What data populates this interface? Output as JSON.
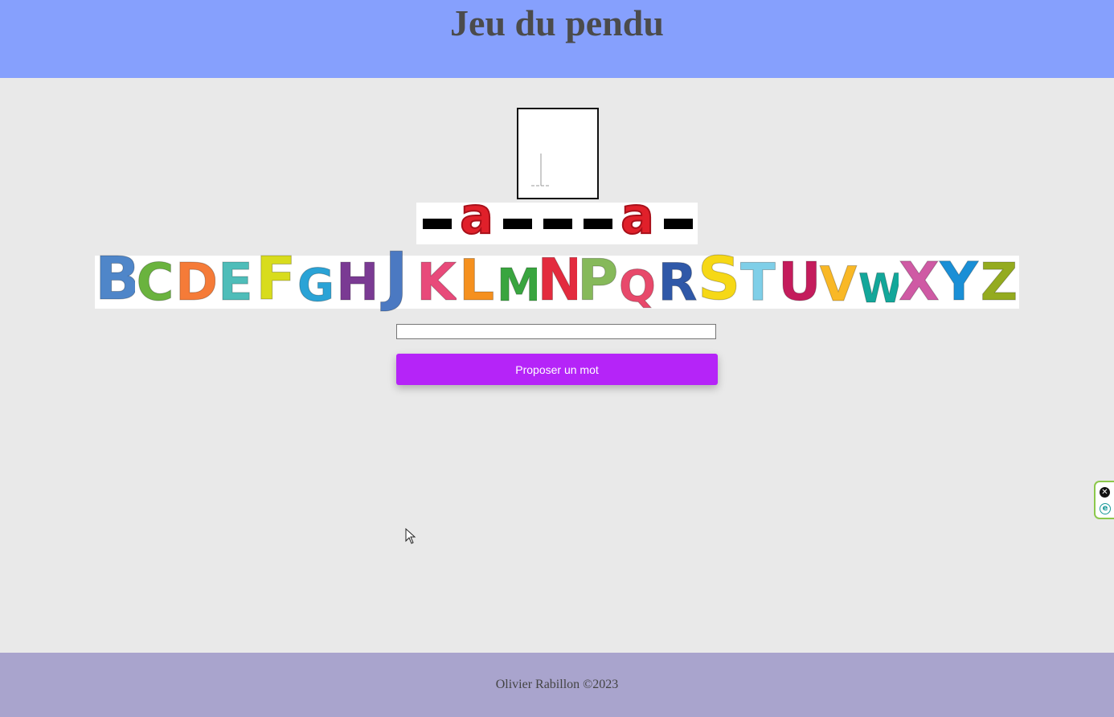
{
  "header": {
    "title": "Jeu du pendu"
  },
  "hangman": {
    "stage": 1
  },
  "word": {
    "slots": [
      {
        "revealed": false,
        "char": ""
      },
      {
        "revealed": true,
        "char": "a"
      },
      {
        "revealed": false,
        "char": ""
      },
      {
        "revealed": false,
        "char": ""
      },
      {
        "revealed": false,
        "char": ""
      },
      {
        "revealed": true,
        "char": "a"
      },
      {
        "revealed": false,
        "char": ""
      }
    ]
  },
  "alphabet": {
    "letters": [
      {
        "char": "B",
        "color": "#4f86c9",
        "size": 74
      },
      {
        "char": "C",
        "color": "#6ab33e",
        "size": 64
      },
      {
        "char": "D",
        "color": "#f57b38",
        "size": 64
      },
      {
        "char": "E",
        "color": "#4fbdb9",
        "size": 64
      },
      {
        "char": "F",
        "color": "#d8dc1d",
        "size": 74
      },
      {
        "char": "G",
        "color": "#2aa3d6",
        "size": 56
      },
      {
        "char": "H",
        "color": "#7a3a93",
        "size": 64
      },
      {
        "char": "J",
        "color": "#4b79c2",
        "size": 80
      },
      {
        "char": "K",
        "color": "#e84a7a",
        "size": 64
      },
      {
        "char": "L",
        "color": "#f5901e",
        "size": 70
      },
      {
        "char": "M",
        "color": "#39a53f",
        "size": 56
      },
      {
        "char": "N",
        "color": "#e32b3e",
        "size": 72
      },
      {
        "char": "P",
        "color": "#86b95a",
        "size": 70
      },
      {
        "char": "Q",
        "color": "#e8496b",
        "size": 54
      },
      {
        "char": "R",
        "color": "#2f58a8",
        "size": 64
      },
      {
        "char": "S",
        "color": "#f6d816",
        "size": 74
      },
      {
        "char": "T",
        "color": "#7fcfe8",
        "size": 64
      },
      {
        "char": "U",
        "color": "#c41c5c",
        "size": 66
      },
      {
        "char": "V",
        "color": "#f9b826",
        "size": 60
      },
      {
        "char": "W",
        "color": "#13a79a",
        "size": 50
      },
      {
        "char": "X",
        "color": "#cf5aa4",
        "size": 66
      },
      {
        "char": "Y",
        "color": "#1a8fd6",
        "size": 66
      },
      {
        "char": "Z",
        "color": "#94ab1f",
        "size": 64
      }
    ]
  },
  "form": {
    "input_value": "",
    "input_placeholder": "",
    "submit_label": "Proposer un mot"
  },
  "side_widget": {
    "close_glyph": "✕",
    "logo_glyph": "e"
  },
  "footer": {
    "text": "Olivier Rabillon ©2023"
  }
}
